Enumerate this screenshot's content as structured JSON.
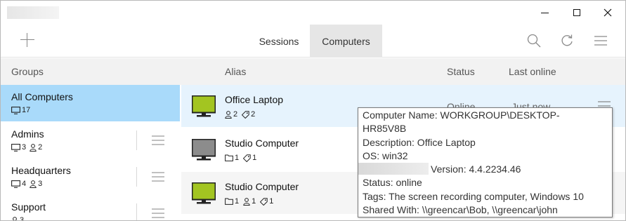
{
  "window": {
    "minimize_icon": "minimize-icon",
    "maximize_icon": "maximize-icon",
    "close_icon": "close-icon"
  },
  "toolbar": {
    "tabs": [
      {
        "label": "Sessions",
        "active": false
      },
      {
        "label": "Computers",
        "active": true
      }
    ],
    "icons": [
      "plus-icon",
      "search-icon",
      "refresh-icon",
      "menu-icon"
    ]
  },
  "header": {
    "groups": "Groups",
    "alias": "Alias",
    "status": "Status",
    "last_online": "Last online"
  },
  "groups": [
    {
      "name": "All Computers",
      "computers": "17",
      "selected": true
    },
    {
      "name": "Admins",
      "computers": "3",
      "users": "2"
    },
    {
      "name": "Headquarters",
      "computers": "4",
      "users": "3"
    },
    {
      "name": "Support",
      "users": "3"
    }
  ],
  "computers": [
    {
      "alias": "Office Laptop",
      "users": "2",
      "tags": "2",
      "status": "Online",
      "last_online": "Just now",
      "color": "#a3c521",
      "online": true
    },
    {
      "alias": "Studio Computer",
      "folders": "1",
      "tags": "1",
      "color": "#8c8c8c",
      "online": false
    },
    {
      "alias": "Studio Computer",
      "folders": "1",
      "users": "1",
      "tags": "1",
      "color": "#a3c521",
      "online": true
    }
  ],
  "tooltip": {
    "line1": "Computer Name: WORKGROUP\\DESKTOP-",
    "line2": "HR85V8B",
    "line3": "Description: Office Laptop",
    "line4": "OS: win32",
    "line5": "Version: 4.4.2234.46",
    "line6": "Status: online",
    "line7": "Tags: The screen recording computer, Windows 10",
    "line8": "Shared With: \\\\greencar\\Bob, \\\\greencar\\john"
  },
  "colors": {
    "selected_group": "#a9dafa",
    "highlight_row": "#e6f3fd",
    "online_monitor": "#a3c521",
    "offline_monitor": "#8c8c8c"
  }
}
